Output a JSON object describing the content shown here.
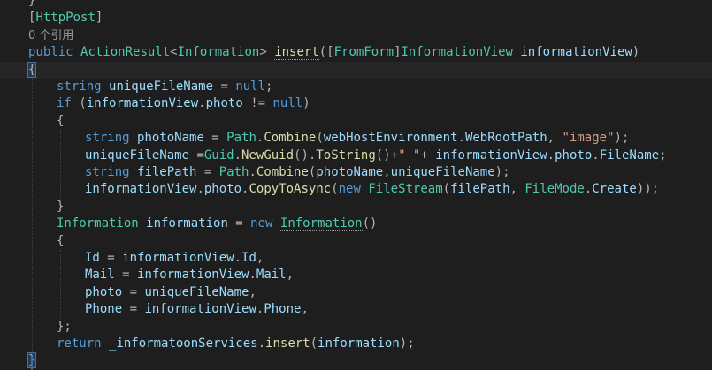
{
  "editor": {
    "lines": [
      {
        "indent": 0,
        "tokens": [
          {
            "t": "}",
            "c": "punct"
          }
        ]
      },
      {
        "indent": 0,
        "tokens": [
          {
            "t": "[",
            "c": "punct"
          },
          {
            "t": "HttpPost",
            "c": "attr"
          },
          {
            "t": "]",
            "c": "punct"
          }
        ]
      },
      {
        "indent": 0,
        "meta": true,
        "tokens": [
          {
            "t": "0 个引用",
            "c": "meta"
          }
        ]
      },
      {
        "indent": 0,
        "tokens": [
          {
            "t": "public ",
            "c": "kw"
          },
          {
            "t": "ActionResult",
            "c": "type"
          },
          {
            "t": "<",
            "c": "punct"
          },
          {
            "t": "Information",
            "c": "type"
          },
          {
            "t": "> ",
            "c": "punct"
          },
          {
            "t": "insert",
            "c": "method",
            "squiggle": true
          },
          {
            "t": "([",
            "c": "punct"
          },
          {
            "t": "FromForm",
            "c": "attr"
          },
          {
            "t": "]",
            "c": "punct"
          },
          {
            "t": "InformationView",
            "c": "type"
          },
          {
            "t": " informationView",
            "c": "ident"
          },
          {
            "t": ")",
            "c": "punct"
          }
        ]
      },
      {
        "indent": 0,
        "tokens": [
          {
            "t": "{",
            "c": "brace"
          }
        ]
      },
      {
        "indent": 1,
        "tokens": [
          {
            "t": "string ",
            "c": "kw"
          },
          {
            "t": "uniqueFileName",
            "c": "ident"
          },
          {
            "t": " = ",
            "c": "punct"
          },
          {
            "t": "null",
            "c": "kw"
          },
          {
            "t": ";",
            "c": "punct"
          }
        ]
      },
      {
        "indent": 1,
        "tokens": [
          {
            "t": "if ",
            "c": "kw"
          },
          {
            "t": "(",
            "c": "punct"
          },
          {
            "t": "informationView",
            "c": "ident"
          },
          {
            "t": ".",
            "c": "punct"
          },
          {
            "t": "photo",
            "c": "ident"
          },
          {
            "t": " != ",
            "c": "punct"
          },
          {
            "t": "null",
            "c": "kw"
          },
          {
            "t": ")",
            "c": "punct"
          }
        ]
      },
      {
        "indent": 1,
        "tokens": [
          {
            "t": "{",
            "c": "punct"
          }
        ]
      },
      {
        "indent": 2,
        "tokens": [
          {
            "t": "string ",
            "c": "kw"
          },
          {
            "t": "photoName",
            "c": "ident"
          },
          {
            "t": " = ",
            "c": "punct"
          },
          {
            "t": "Path",
            "c": "type"
          },
          {
            "t": ".",
            "c": "punct"
          },
          {
            "t": "Combine",
            "c": "method"
          },
          {
            "t": "(",
            "c": "punct"
          },
          {
            "t": "webHostEnvironment",
            "c": "ident"
          },
          {
            "t": ".",
            "c": "punct"
          },
          {
            "t": "WebRootPath",
            "c": "ident"
          },
          {
            "t": ", ",
            "c": "punct"
          },
          {
            "t": "\"image\"",
            "c": "str"
          },
          {
            "t": ");",
            "c": "punct"
          }
        ]
      },
      {
        "indent": 2,
        "tokens": [
          {
            "t": "uniqueFileName",
            "c": "ident"
          },
          {
            "t": " =",
            "c": "punct"
          },
          {
            "t": "Guid",
            "c": "type"
          },
          {
            "t": ".",
            "c": "punct"
          },
          {
            "t": "NewGuid",
            "c": "method"
          },
          {
            "t": "().",
            "c": "punct"
          },
          {
            "t": "ToString",
            "c": "method"
          },
          {
            "t": "()+",
            "c": "punct"
          },
          {
            "t": "\"_\"",
            "c": "str"
          },
          {
            "t": "+ ",
            "c": "punct"
          },
          {
            "t": "informationView",
            "c": "ident"
          },
          {
            "t": ".",
            "c": "punct"
          },
          {
            "t": "photo",
            "c": "ident"
          },
          {
            "t": ".",
            "c": "punct"
          },
          {
            "t": "FileName",
            "c": "ident"
          },
          {
            "t": ";",
            "c": "punct"
          }
        ]
      },
      {
        "indent": 2,
        "tokens": [
          {
            "t": "string ",
            "c": "kw"
          },
          {
            "t": "filePath",
            "c": "ident"
          },
          {
            "t": " = ",
            "c": "punct"
          },
          {
            "t": "Path",
            "c": "type"
          },
          {
            "t": ".",
            "c": "punct"
          },
          {
            "t": "Combine",
            "c": "method"
          },
          {
            "t": "(",
            "c": "punct"
          },
          {
            "t": "photoName",
            "c": "ident"
          },
          {
            "t": ",",
            "c": "punct"
          },
          {
            "t": "uniqueFileName",
            "c": "ident"
          },
          {
            "t": ");",
            "c": "punct"
          }
        ]
      },
      {
        "indent": 2,
        "tokens": [
          {
            "t": "informationView",
            "c": "ident"
          },
          {
            "t": ".",
            "c": "punct"
          },
          {
            "t": "photo",
            "c": "ident"
          },
          {
            "t": ".",
            "c": "punct"
          },
          {
            "t": "CopyToAsync",
            "c": "method"
          },
          {
            "t": "(",
            "c": "punct"
          },
          {
            "t": "new ",
            "c": "kw"
          },
          {
            "t": "FileStream",
            "c": "type"
          },
          {
            "t": "(",
            "c": "punct"
          },
          {
            "t": "filePath",
            "c": "ident"
          },
          {
            "t": ", ",
            "c": "punct"
          },
          {
            "t": "FileMode",
            "c": "type"
          },
          {
            "t": ".",
            "c": "punct"
          },
          {
            "t": "Create",
            "c": "ident"
          },
          {
            "t": "));",
            "c": "punct"
          }
        ]
      },
      {
        "indent": 1,
        "tokens": [
          {
            "t": "}",
            "c": "punct"
          }
        ]
      },
      {
        "indent": 1,
        "tokens": [
          {
            "t": "Information ",
            "c": "type"
          },
          {
            "t": "information",
            "c": "ident"
          },
          {
            "t": " = ",
            "c": "punct"
          },
          {
            "t": "new ",
            "c": "kw"
          },
          {
            "t": "Information",
            "c": "type",
            "squiggle": true
          },
          {
            "t": "()",
            "c": "punct"
          }
        ]
      },
      {
        "indent": 1,
        "tokens": [
          {
            "t": "{",
            "c": "punct"
          }
        ]
      },
      {
        "indent": 2,
        "tokens": [
          {
            "t": "Id",
            "c": "ident"
          },
          {
            "t": " = ",
            "c": "punct"
          },
          {
            "t": "informationView",
            "c": "ident"
          },
          {
            "t": ".",
            "c": "punct"
          },
          {
            "t": "Id",
            "c": "ident"
          },
          {
            "t": ",",
            "c": "punct"
          }
        ]
      },
      {
        "indent": 2,
        "tokens": [
          {
            "t": "Mail",
            "c": "ident"
          },
          {
            "t": " = ",
            "c": "punct"
          },
          {
            "t": "informationView",
            "c": "ident"
          },
          {
            "t": ".",
            "c": "punct"
          },
          {
            "t": "Mail",
            "c": "ident"
          },
          {
            "t": ",",
            "c": "punct"
          }
        ]
      },
      {
        "indent": 2,
        "tokens": [
          {
            "t": "photo",
            "c": "ident"
          },
          {
            "t": " = ",
            "c": "punct"
          },
          {
            "t": "uniqueFileName",
            "c": "ident"
          },
          {
            "t": ",",
            "c": "punct"
          }
        ]
      },
      {
        "indent": 2,
        "tokens": [
          {
            "t": "Phone",
            "c": "ident"
          },
          {
            "t": " = ",
            "c": "punct"
          },
          {
            "t": "informationView",
            "c": "ident"
          },
          {
            "t": ".",
            "c": "punct"
          },
          {
            "t": "Phone",
            "c": "ident"
          },
          {
            "t": ",",
            "c": "punct"
          }
        ]
      },
      {
        "indent": 1,
        "tokens": [
          {
            "t": "};",
            "c": "punct"
          }
        ]
      },
      {
        "indent": 1,
        "tokens": [
          {
            "t": "return ",
            "c": "kw"
          },
          {
            "t": "_informatoonServices",
            "c": "ident"
          },
          {
            "t": ".",
            "c": "punct"
          },
          {
            "t": "insert",
            "c": "method"
          },
          {
            "t": "(",
            "c": "punct"
          },
          {
            "t": "information",
            "c": "ident"
          },
          {
            "t": ");",
            "c": "punct"
          }
        ]
      },
      {
        "indent": 0,
        "tokens": [
          {
            "t": "}",
            "c": "brace"
          }
        ]
      }
    ]
  }
}
